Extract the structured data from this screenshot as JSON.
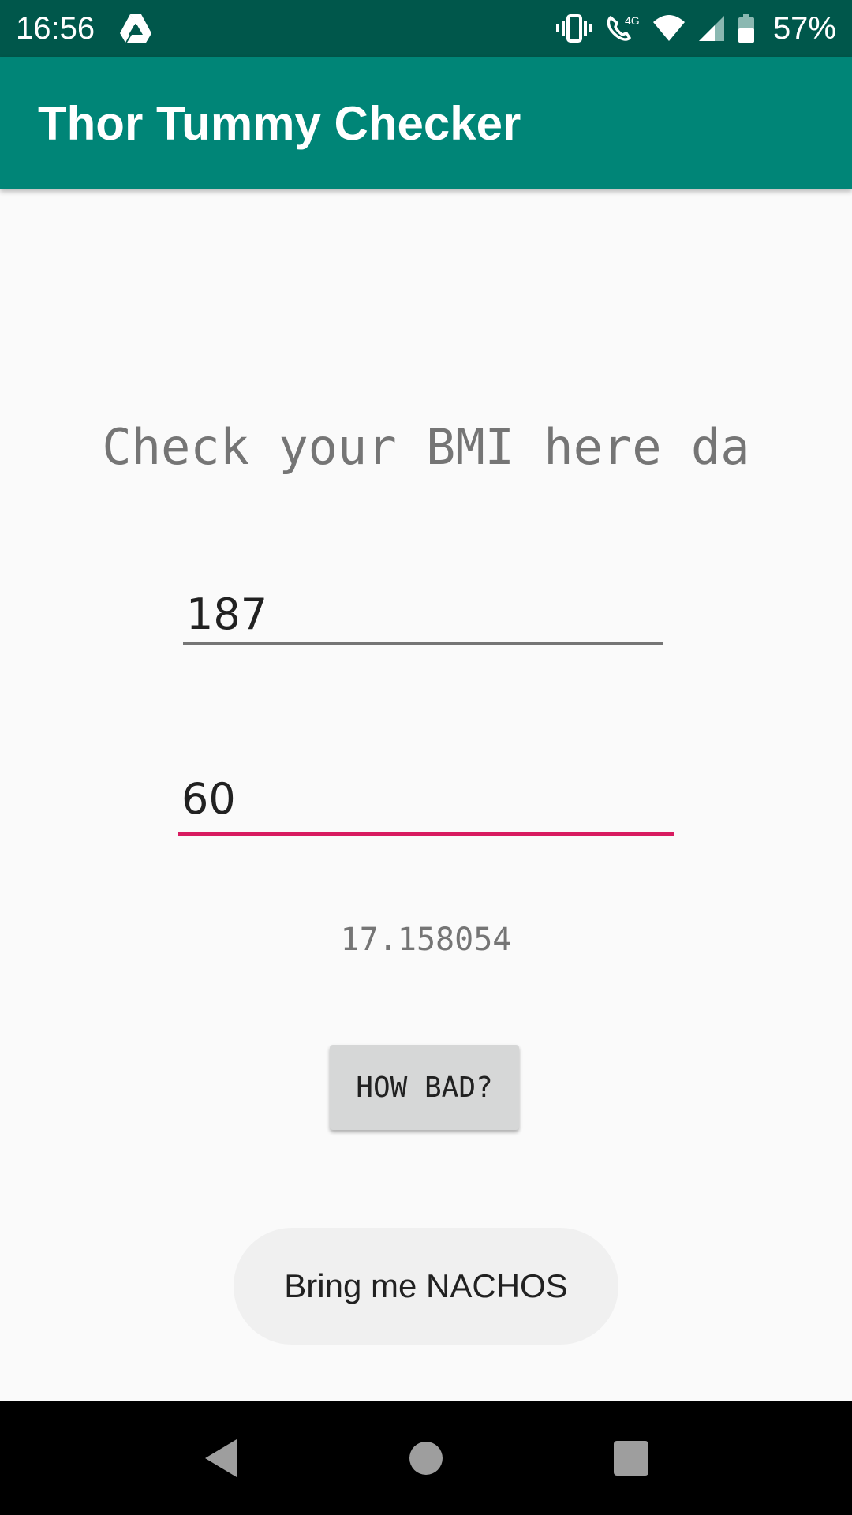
{
  "status_bar": {
    "time": "16:56",
    "battery": "57%",
    "icons": [
      "drive-icon",
      "vibrate-icon",
      "wifi-calling-4g-icon",
      "wifi-icon",
      "signal-icon",
      "battery-icon"
    ],
    "network_badge": "4G"
  },
  "app_bar": {
    "title": "Thor Tummy Checker"
  },
  "main": {
    "heading": "Check your BMI here da",
    "height_value": "187",
    "weight_value": "60",
    "result": "17.158054",
    "how_bad_label": "HOW BAD?",
    "nachos_label": "Bring me NACHOS"
  },
  "nav_bar": {
    "icons": [
      "back-icon",
      "home-icon",
      "recents-icon"
    ]
  },
  "colors": {
    "status_bar": "#00574b",
    "app_bar": "#008577",
    "accent": "#d81b60",
    "background": "#fafafa"
  }
}
